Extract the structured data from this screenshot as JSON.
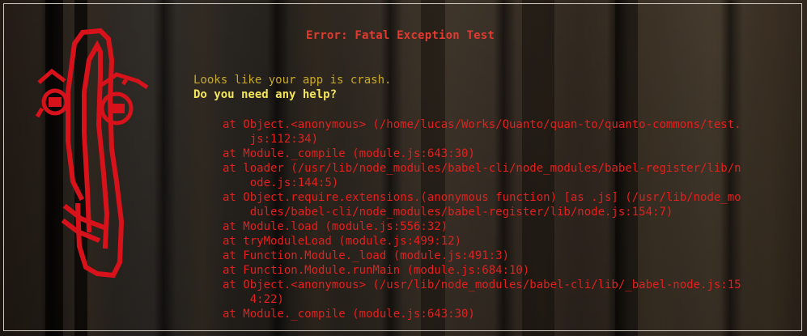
{
  "title": "Error: Fatal Exception Test",
  "messages": {
    "line1": "Looks like your app is crash.",
    "line2": "Do you need any help?"
  },
  "stack_lines": [
    "at Object.<anonymous> (/home/lucas/Works/Quanto/quan-to/quanto-commons/test.",
    "    js:112:34)",
    "at Module._compile (module.js:643:30)",
    "at loader (/usr/lib/node_modules/babel-cli/node_modules/babel-register/lib/n",
    "    ode.js:144:5)",
    "at Object.require.extensions.(anonymous function) [as .js] (/usr/lib/node_mo",
    "    dules/babel-cli/node_modules/babel-register/lib/node.js:154:7)",
    "at Module.load (module.js:556:32)",
    "at tryModuleLoad (module.js:499:12)",
    "at Function.Module._load (module.js:491:3)",
    "at Function.Module.runMain (module.js:684:10)",
    "at Object.<anonymous> (/usr/lib/node_modules/babel-cli/lib/_babel-node.js:15",
    "    4:22)",
    "at Module._compile (module.js:643:30)"
  ],
  "colors": {
    "title": "#e33a2f",
    "message": "#c8a82c",
    "help": "#f4e65a",
    "stack": "#e3201e",
    "clippy": "#d8121a"
  },
  "icons": {
    "mascot": "paperclip-mascot-icon"
  }
}
